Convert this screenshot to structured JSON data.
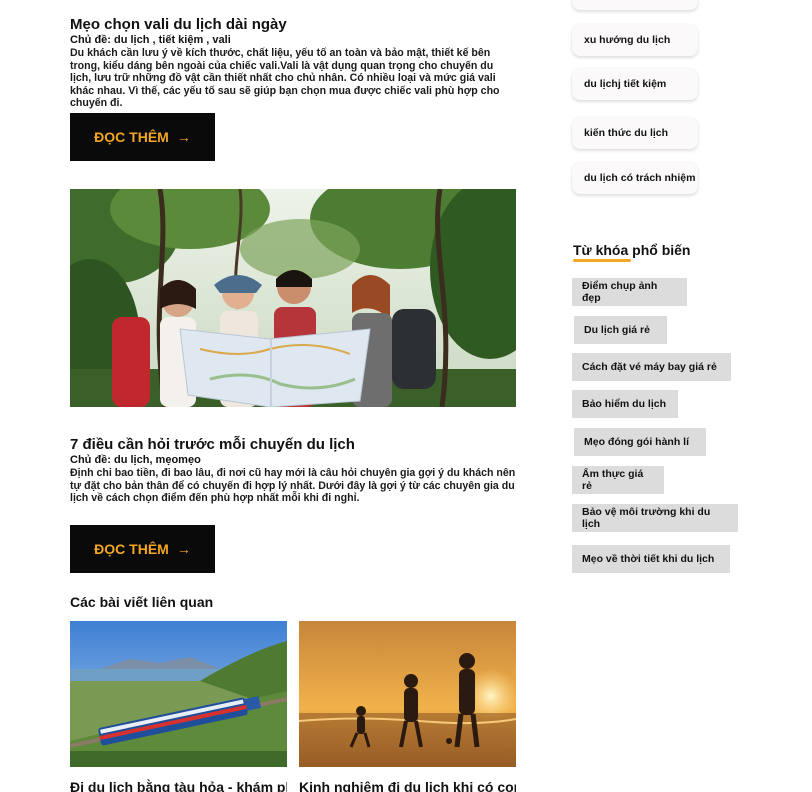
{
  "articles": [
    {
      "title": "Mẹo chọn vali du lịch dài ngày",
      "topic": "Chủ đề: du lịch , tiết kiệm , vali",
      "excerpt": "Du khách cần lưu ý về kích thước, chất liệu, yếu tố an toàn và bảo mật, thiết kế bên trong, kiểu dáng bên ngoài của chiếc vali.Vali là vật dụng quan trọng cho chuyến du lịch, lưu trữ những đồ vật cần thiết nhất cho chủ nhân. Có nhiều loại và mức giá vali khác nhau. Vì thế, các yếu tố sau sẽ giúp bạn chọn mua được chiếc vali phù hợp cho chuyến đi.",
      "read_more": "ĐỌC THÊM"
    },
    {
      "title": "7 điều cần hỏi trước mỗi chuyến du lịch",
      "topic": "Chủ đề: du lịch, mẹomẹo",
      "excerpt": "Định chi bao tiền, đi bao lâu, đi nơi cũ hay mới là câu hỏi chuyên gia gợi ý du khách nên tự đặt cho bản thân để có chuyến đi hợp lý nhất. Dưới đây là gợi ý từ các chuyên gia du lịch về cách chọn điểm đến phù hợp nhất mỗi khi đi nghỉ.",
      "read_more": "ĐỌC THÊM"
    }
  ],
  "related": {
    "title": "Các bài viết liên quan",
    "items": [
      {
        "caption": "Đi du lịch bằng tàu hỏa - khám phá"
      },
      {
        "caption": "Kinh nghiệm đi du lịch khi có con nhỏ"
      }
    ]
  },
  "sidebar": {
    "categories": [
      "xu hướng du lịch",
      "du lịchj tiết kiệm",
      "kiến thức du lịch",
      "du lịch có trách nhiệm"
    ],
    "keywords_title": "Từ khóa phổ biến",
    "keywords": [
      "Điểm chụp ảnh đẹp",
      "Du lịch giá rẻ",
      "Cách đặt vé máy bay giá rẻ",
      "Bảo hiểm du lịch",
      "Mẹo đóng gói hành lí",
      "Ẩm thực giá rẻ",
      "Bảo vệ môi trường khi du lịch",
      "Mẹo về thời tiết khi du lịch"
    ]
  },
  "colors": {
    "accent": "#f4a623",
    "button_bg": "#0a0a0a",
    "tag_bg": "#dcdcdc"
  },
  "icons": {
    "arrow": "arrow-right-icon"
  }
}
